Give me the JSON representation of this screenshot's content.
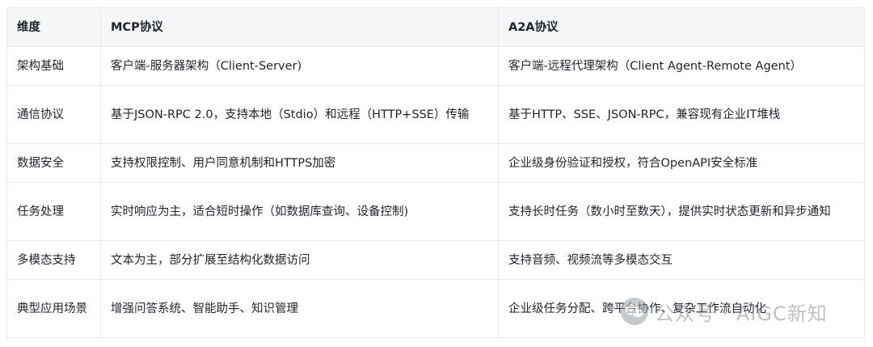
{
  "table": {
    "headers": [
      "维度",
      "MCP协议",
      "A2A协议"
    ],
    "rows": [
      [
        "架构基础",
        "客户端-服务器架构（Client-Server)",
        "客户端-远程代理架构（Client Agent-Remote Agent）"
      ],
      [
        "通信协议",
        "基于JSON-RPC 2.0，支持本地（Stdio）和远程（HTTP+SSE）传输",
        "基于HTTP、SSE、JSON-RPC，兼容现有企业IT堆栈"
      ],
      [
        "数据安全",
        "支持权限控制、用户同意机制和HTTPS加密",
        "企业级身份验证和授权，符合OpenAPI安全标准"
      ],
      [
        "任务处理",
        "实时响应为主，适合短时操作（如数据库查询、设备控制)",
        "支持长时任务（数小时至数天），提供实时状态更新和异步通知"
      ],
      [
        "多模态支持",
        "文本为主，部分扩展至结构化数据访问",
        "支持音频、视频流等多模态交互"
      ],
      [
        "典型应用场景",
        "增强问答系统、智能助手、知识管理",
        "企业级任务分配、跨平台协作、复杂工作流自动化"
      ]
    ]
  },
  "watermark": {
    "text": "公众号 · AIGC新知",
    "icon": "wechat-icon"
  }
}
